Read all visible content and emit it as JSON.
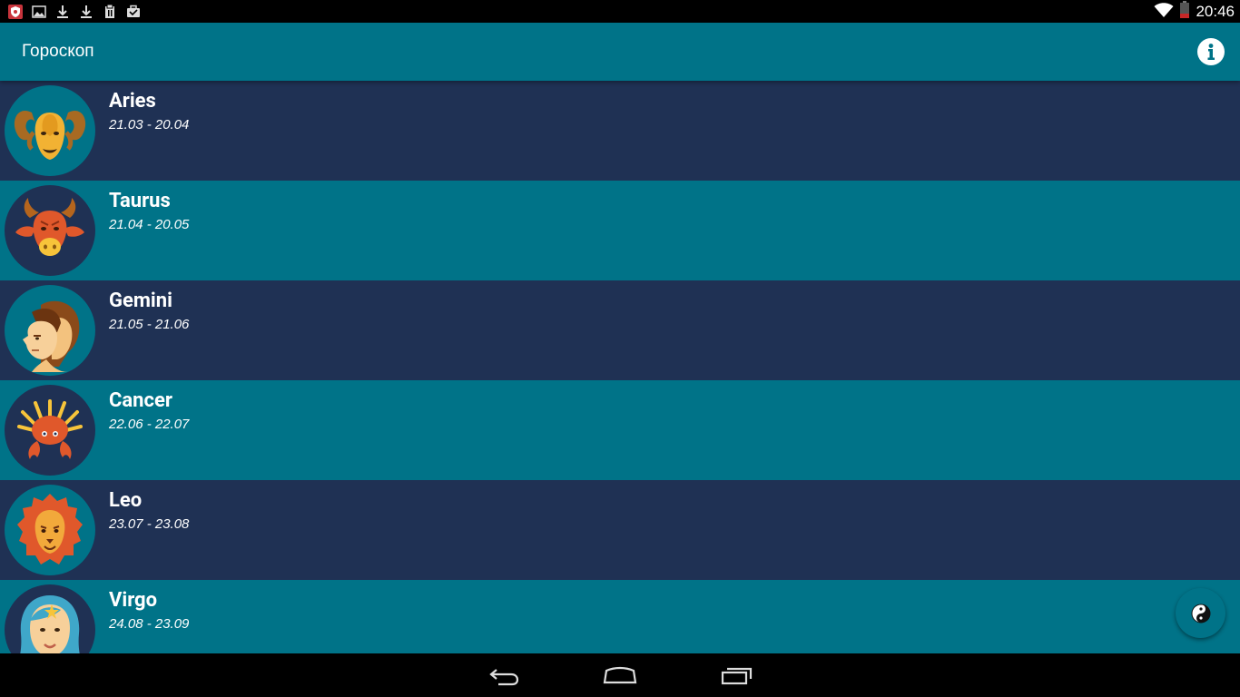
{
  "status_bar": {
    "time": "20:46",
    "notification_icons": [
      "shield-icon",
      "image-icon",
      "download-icon",
      "download-icon",
      "clipboard-icon",
      "briefcase-icon"
    ],
    "system_icons": [
      "wifi-icon",
      "battery-icon"
    ]
  },
  "app_bar": {
    "title": "Гороскоп",
    "info_icon": "info-icon"
  },
  "signs": [
    {
      "name": "Aries",
      "dates": "21.03 - 20.04",
      "icon": "aries-icon"
    },
    {
      "name": "Taurus",
      "dates": "21.04 - 20.05",
      "icon": "taurus-icon"
    },
    {
      "name": "Gemini",
      "dates": "21.05 - 21.06",
      "icon": "gemini-icon"
    },
    {
      "name": "Cancer",
      "dates": "22.06 - 22.07",
      "icon": "cancer-icon"
    },
    {
      "name": "Leo",
      "dates": "23.07 - 23.08",
      "icon": "leo-icon"
    },
    {
      "name": "Virgo",
      "dates": "24.08 - 23.09",
      "icon": "virgo-icon"
    }
  ],
  "colors": {
    "primary": "#007388",
    "dark_row": "#1f3154",
    "text": "#ffffff"
  },
  "fab": {
    "icon": "yin-yang-icon"
  },
  "nav_bar": {
    "buttons": [
      "back-icon",
      "home-icon",
      "recents-icon"
    ]
  }
}
